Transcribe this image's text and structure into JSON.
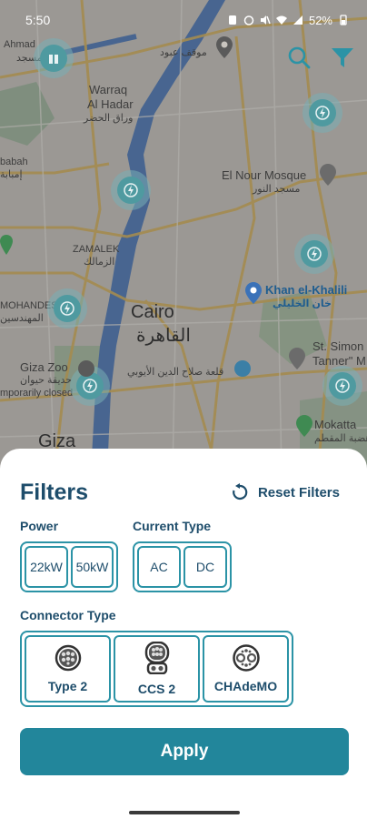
{
  "status_bar": {
    "time": "5:50",
    "battery": "52%"
  },
  "map": {
    "labels": {
      "ahmad_top": "Ahmad",
      "mosque_top_ar": "مسجد",
      "mawqaf_ar": "موقف عبود",
      "warraq_en": "Warraq",
      "al_hadar_en": "Al Hadar",
      "warraq_ar": "وراق الحضر",
      "babah_en": "babah",
      "babah_ar": "إمبابة",
      "el_nour_en": "El Nour Mosque",
      "el_nour_ar": "مسجد النور",
      "zamalek_en": "ZAMALEK",
      "zamalek_ar": "الزمالك",
      "mohandessin_en": "MOHANDESSIN",
      "mohandessin_ar": "المهندسين",
      "khan_en": "Khan el-Khalili",
      "khan_ar": "خان الخليلي",
      "cairo_en": "Cairo",
      "cairo_ar": "القاهرة",
      "st_simon_1": "St. Simon",
      "st_simon_2": "Tanner\" M",
      "giza_zoo_en": "Giza Zoo",
      "giza_zoo_ar": "حديقة حيوان",
      "temporarily_closed": "mporarily closed",
      "citadel_ar": "قلعة صلاح الدين الأيوبي",
      "mokattam_en": "Mokatta",
      "mokattam_ar": "هضبة المقطم",
      "giza_en": "Giza"
    }
  },
  "colors": {
    "accent": "#2b93a6",
    "title": "#1e4d6b",
    "apply_bg": "#22869b",
    "pin": "#4f9aa0"
  },
  "filters": {
    "title": "Filters",
    "reset_label": "Reset Filters",
    "power": {
      "label": "Power",
      "options": [
        "22kW",
        "50kW"
      ]
    },
    "current_type": {
      "label": "Current Type",
      "options": [
        "AC",
        "DC"
      ]
    },
    "connector_type": {
      "label": "Connector Type",
      "options": [
        {
          "label": "Type 2",
          "icon": "type2-connector-icon"
        },
        {
          "label": "CCS 2",
          "icon": "ccs2-connector-icon"
        },
        {
          "label": "CHAdeMO",
          "icon": "chademo-connector-icon"
        }
      ]
    },
    "apply_label": "Apply"
  }
}
